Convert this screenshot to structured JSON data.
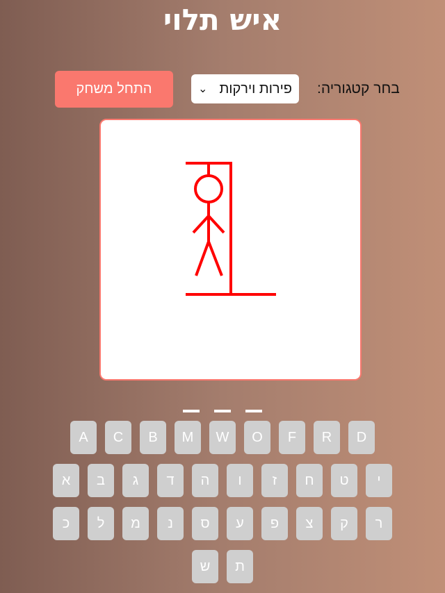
{
  "header": {
    "title": "איש תלוי"
  },
  "controls": {
    "category_label": "בחר קטגוריה:",
    "selected_category": "פירות וירקות",
    "start_button": "התחל משחק"
  },
  "game": {
    "word_slots": 3,
    "figure_color": "#ff0000",
    "accent_color": "#fa786e"
  },
  "keyboard": {
    "rows": [
      [
        "A",
        "C",
        "B",
        "M",
        "W",
        "O",
        "F",
        "R",
        "D"
      ],
      [
        "א",
        "ב",
        "ג",
        "ד",
        "ה",
        "ו",
        "ז",
        "ח",
        "ט",
        "י"
      ],
      [
        "כ",
        "ל",
        "מ",
        "נ",
        "ס",
        "ע",
        "פ",
        "צ",
        "ק",
        "ר"
      ],
      [
        "ש",
        "ת"
      ]
    ]
  }
}
